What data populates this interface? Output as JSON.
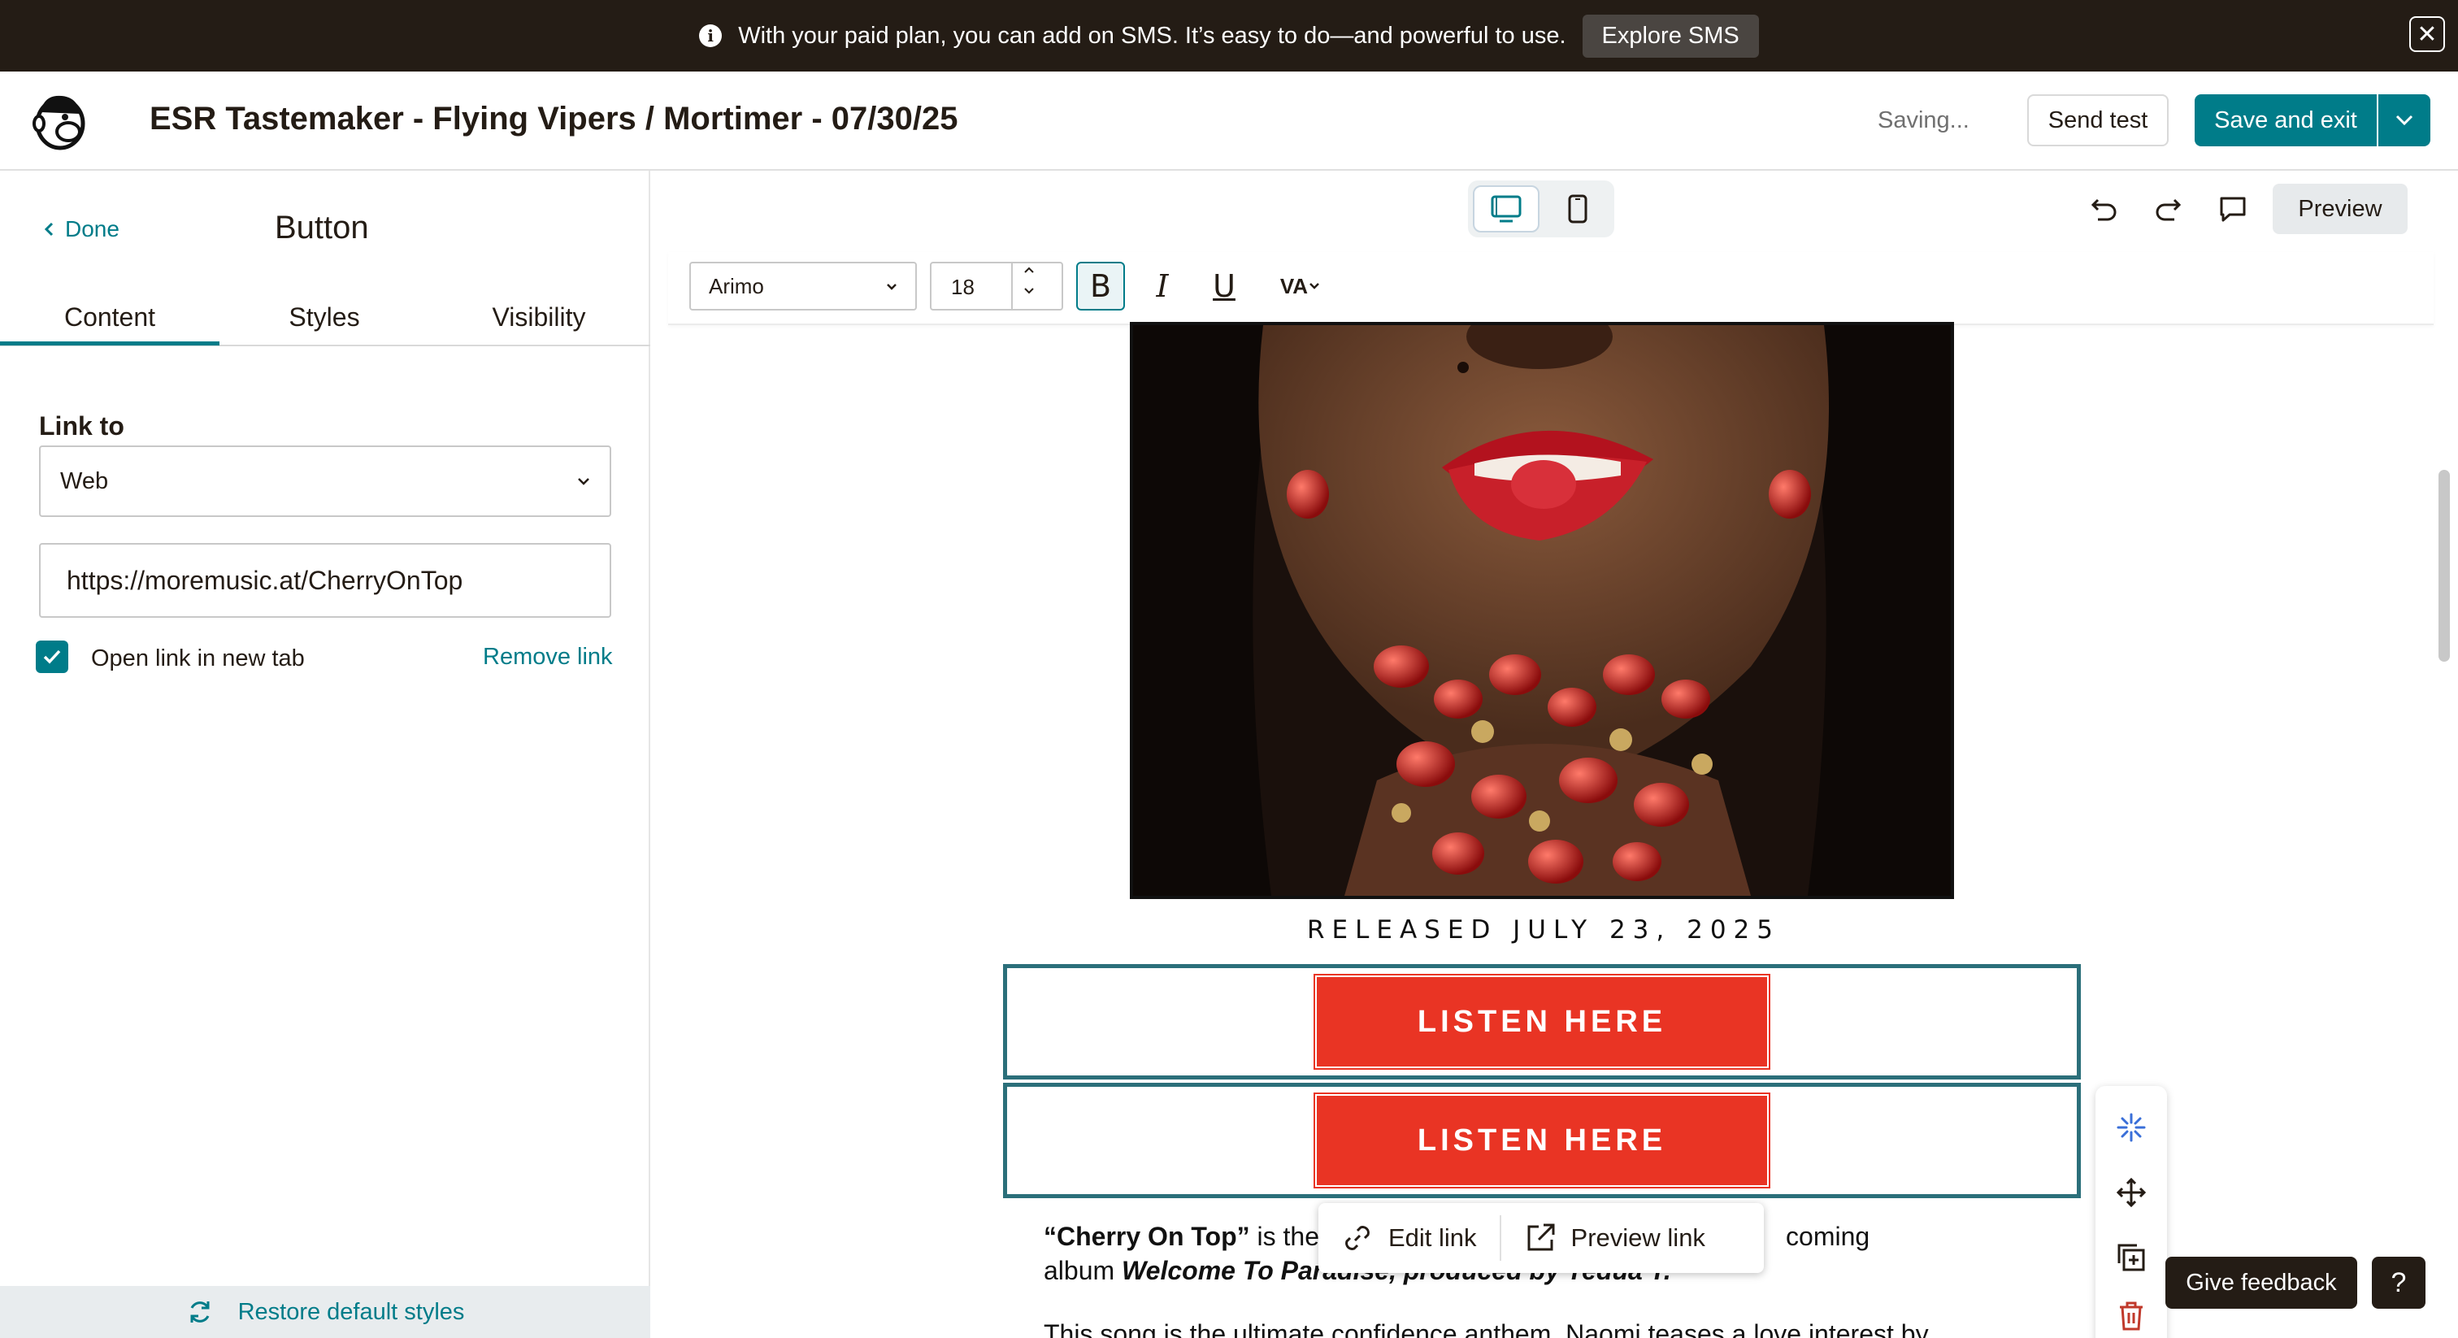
{
  "banner": {
    "message": "With your paid plan, you can add on SMS. It’s easy to do—and powerful to use.",
    "button_label": "Explore SMS",
    "info_icon": "i",
    "close_icon": "✕"
  },
  "header": {
    "title": "ESR Tastemaker - Flying Vipers / Mortimer - 07/30/25",
    "status": "Saving...",
    "send_test_label": "Send test",
    "save_exit_label": "Save and exit",
    "save_dropdown_icon": "⌄"
  },
  "sidebar": {
    "done_label": "Done",
    "panel_title": "Button",
    "tabs": [
      {
        "label": "Content",
        "active": true
      },
      {
        "label": "Styles",
        "active": false
      },
      {
        "label": "Visibility",
        "active": false
      }
    ],
    "link_to_label": "Link to",
    "link_type_value": "Web",
    "url_value": "https://moremusic.at/CherryOnTop",
    "open_new_tab_label": "Open link in new tab",
    "open_new_tab_checked": true,
    "remove_link_label": "Remove link",
    "restore_label": "Restore default styles"
  },
  "editor": {
    "preview_label": "Preview",
    "font_value": "Arimo",
    "font_size_value": "18",
    "bold_label": "B",
    "italic_label": "I",
    "underline_label": "U",
    "spacing_label": "VA"
  },
  "email": {
    "released_text": "RELEASED JULY 23, 2025",
    "button1_label": "LISTEN HERE",
    "button2_label": "LISTEN HERE",
    "para1_bold": "“Cherry On Top”",
    "para1_text_a": " is the",
    "para1_text_b": "coming",
    "para1_line2_a": "album ",
    "para1_line2_italic": "Welcome To Pa",
    "para1_line2_b": "radise, produced by Tedua T.",
    "para2_text": "This song is the ultimate confidence anthem. Naomi teases a love interest by"
  },
  "link_popup": {
    "edit_label": "Edit link",
    "preview_label": "Preview link"
  },
  "feedback": {
    "label": "Give feedback",
    "help_label": "?"
  },
  "colors": {
    "accent": "#007c89",
    "button_red": "#e93424",
    "dark": "#241c15"
  }
}
